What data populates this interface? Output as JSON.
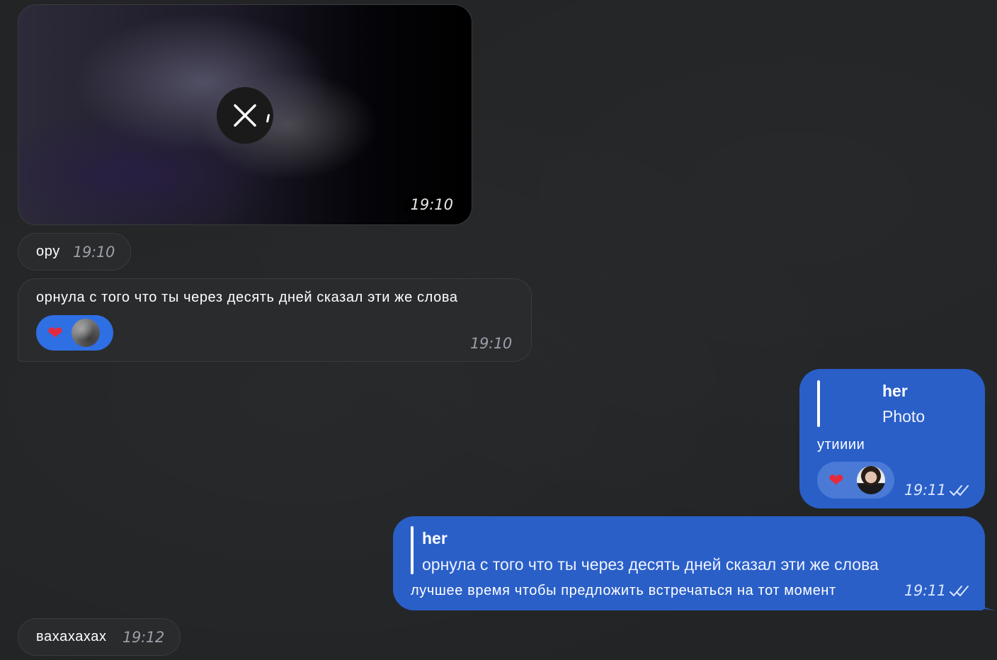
{
  "messages": {
    "media": {
      "time": "19:10"
    },
    "m1": {
      "text": "ору",
      "time": "19:10"
    },
    "m2": {
      "text": "орнула с того что ты через десять дней сказал эти же слова",
      "time": "19:10"
    },
    "m3": {
      "reply_author": "her",
      "reply_text": "Photo",
      "text": "утииии",
      "time": "19:11"
    },
    "m4": {
      "reply_author": "her",
      "reply_text": "орнула с того что ты через десять дней сказал эти же слова",
      "text": "лучшее время чтобы предложить встречаться на тот момент",
      "time": "19:11"
    },
    "m5": {
      "text": "вахахахах",
      "time": "19:12"
    }
  },
  "colors": {
    "background": "#222426",
    "incoming_bubble": "#2a2b2d",
    "outgoing_bubble": "#2a5fc8",
    "reaction_incoming": "#2f6fe4",
    "reaction_outgoing": "#4b7ad6",
    "heart": "#e8283b"
  },
  "icons": {
    "media_close": "close-icon",
    "reaction": "heart-icon",
    "read_status": "double-check-icon"
  }
}
